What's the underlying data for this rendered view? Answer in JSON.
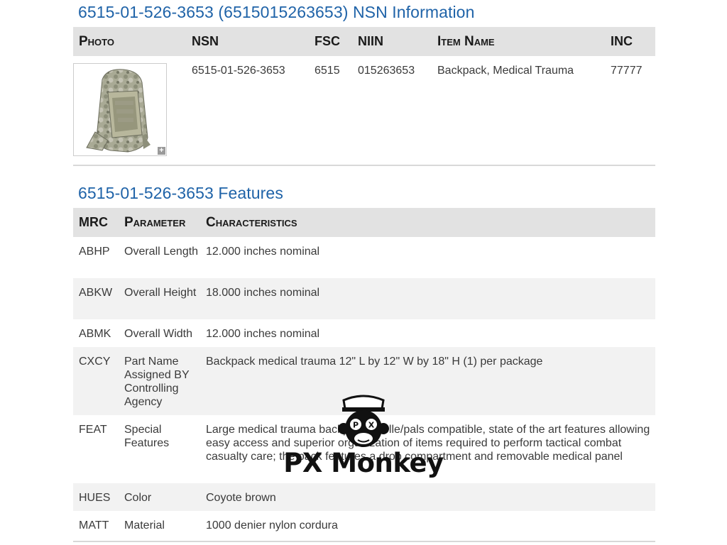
{
  "nsn_section": {
    "title": "6515-01-526-3653 (6515015263653) NSN Information",
    "headers": [
      "Photo",
      "NSN",
      "FSC",
      "NIIN",
      "Item Name",
      "INC"
    ],
    "row": {
      "nsn": "6515-01-526-3653",
      "fsc": "6515",
      "niin": "015263653",
      "item_name": "Backpack, Medical Trauma",
      "inc": "77777"
    },
    "zoom_icon": "plus-icon"
  },
  "features_section": {
    "title": "6515-01-526-3653 Features",
    "headers": [
      "MRC",
      "Parameter",
      "Characteristics"
    ],
    "rows": [
      {
        "mrc": "ABHP",
        "parameter": "Overall Length",
        "characteristics": "12.000 inches nominal"
      },
      {
        "mrc": "ABKW",
        "parameter": "Overall Height",
        "characteristics": "18.000 inches nominal"
      },
      {
        "mrc": "ABMK",
        "parameter": "Overall Width",
        "characteristics": "12.000 inches nominal"
      },
      {
        "mrc": "CXCY",
        "parameter": "Part Name Assigned BY Controlling Agency",
        "characteristics": "Backpack medical trauma 12\" L by 12\" W by 18\" H (1) per package"
      },
      {
        "mrc": "FEAT",
        "parameter": "Special Features",
        "characteristics": "Large medical trauma backpack; molle/pals compatible, state of the art features allowing easy access and superior organization of items required to perform tactical combat casualty care; the pack features a drop compartment and removable medical panel"
      },
      {
        "mrc": "HUES",
        "parameter": "Color",
        "characteristics": "Coyote brown"
      },
      {
        "mrc": "MATT",
        "parameter": "Material",
        "characteristics": "1000 denier nylon cordura"
      }
    ]
  },
  "watermark": {
    "text": "PX Monkey",
    "badge": "P X"
  },
  "colors": {
    "title_blue": "#1f63a8",
    "header_bg": "#e2e2e2",
    "alt_row_bg": "#f2f2f2"
  }
}
